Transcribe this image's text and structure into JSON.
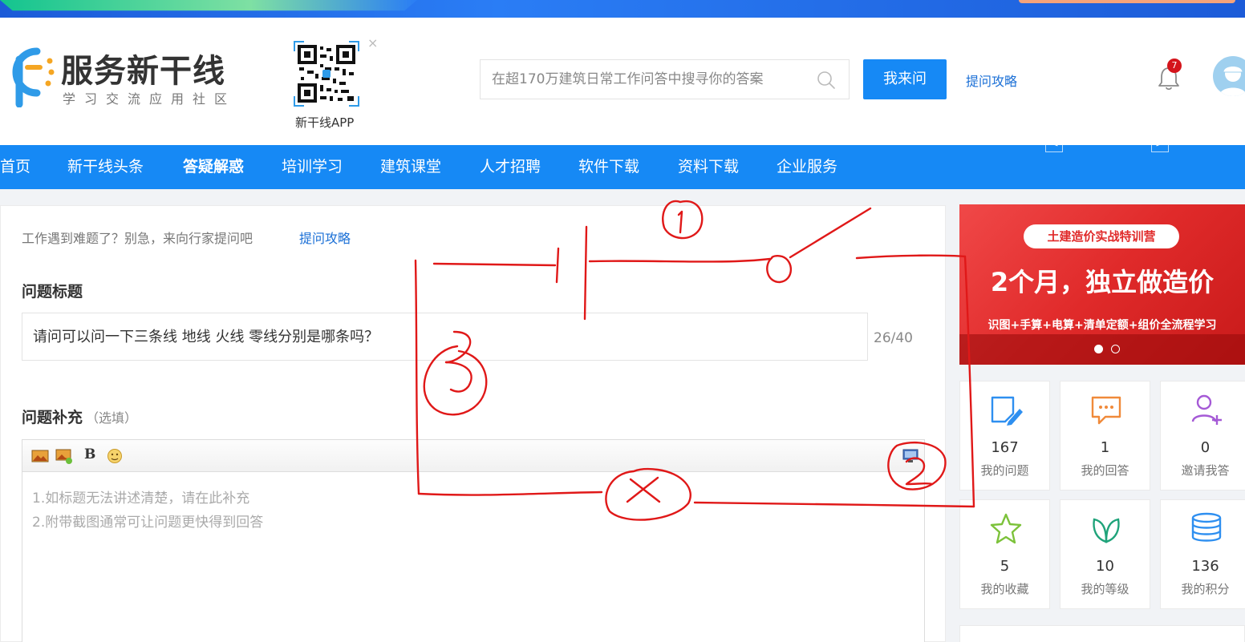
{
  "header": {
    "logo_title": "服务新干线",
    "logo_subtitle": "学习交流应用社区",
    "qr_label": "新干线APP",
    "qr_close": "×",
    "search_placeholder": "在超170万建筑日常工作问答中搜寻你的答案",
    "ask_button": "我来问",
    "guide_link": "提问攻略",
    "notification_count": "7"
  },
  "nav": {
    "items": [
      "首页",
      "新干线头条",
      "答疑解惑",
      "培训学习",
      "建筑课堂",
      "人才招聘",
      "软件下载",
      "资料下载",
      "企业服务"
    ],
    "active": "答疑解惑"
  },
  "form": {
    "hint": "工作遇到难题了？别急，来向行家提问吧",
    "hint_link": "提问攻略",
    "title_label": "问题标题",
    "title_value": "请问可以问一下三条线 地线 火线 零线分别是哪条吗？",
    "counter": "26/40",
    "supp_label": "问题补充",
    "supp_optional": "（选填）",
    "bold_label": "B",
    "editor_placeholder_1": "1.如标题无法讲述清楚，请在此补充",
    "editor_placeholder_2": "2.附带截图通常可让问题更快得到回答"
  },
  "ad": {
    "pill": "土建造价实战特训营",
    "main": "2个月，独立做造价",
    "line": "识图+手算+电算+清单定额+组价全流程学习",
    "prev": "<",
    "next": ">"
  },
  "stats": [
    {
      "value": "167",
      "label": "我的问题",
      "icon": "edit-icon"
    },
    {
      "value": "1",
      "label": "我的回答",
      "icon": "chat-icon"
    },
    {
      "value": "0",
      "label": "邀请我答",
      "icon": "add-user-icon"
    },
    {
      "value": "5",
      "label": "我的收藏",
      "icon": "star-icon"
    },
    {
      "value": "10",
      "label": "我的等级",
      "icon": "leaf-icon"
    },
    {
      "value": "136",
      "label": "我的积分",
      "icon": "coins-icon"
    }
  ],
  "colors": {
    "primary": "#1689f5",
    "link": "#1a6fd6",
    "badge": "#d4141b",
    "ad_red": "#e02a2a",
    "annotation_red": "#e01818"
  }
}
